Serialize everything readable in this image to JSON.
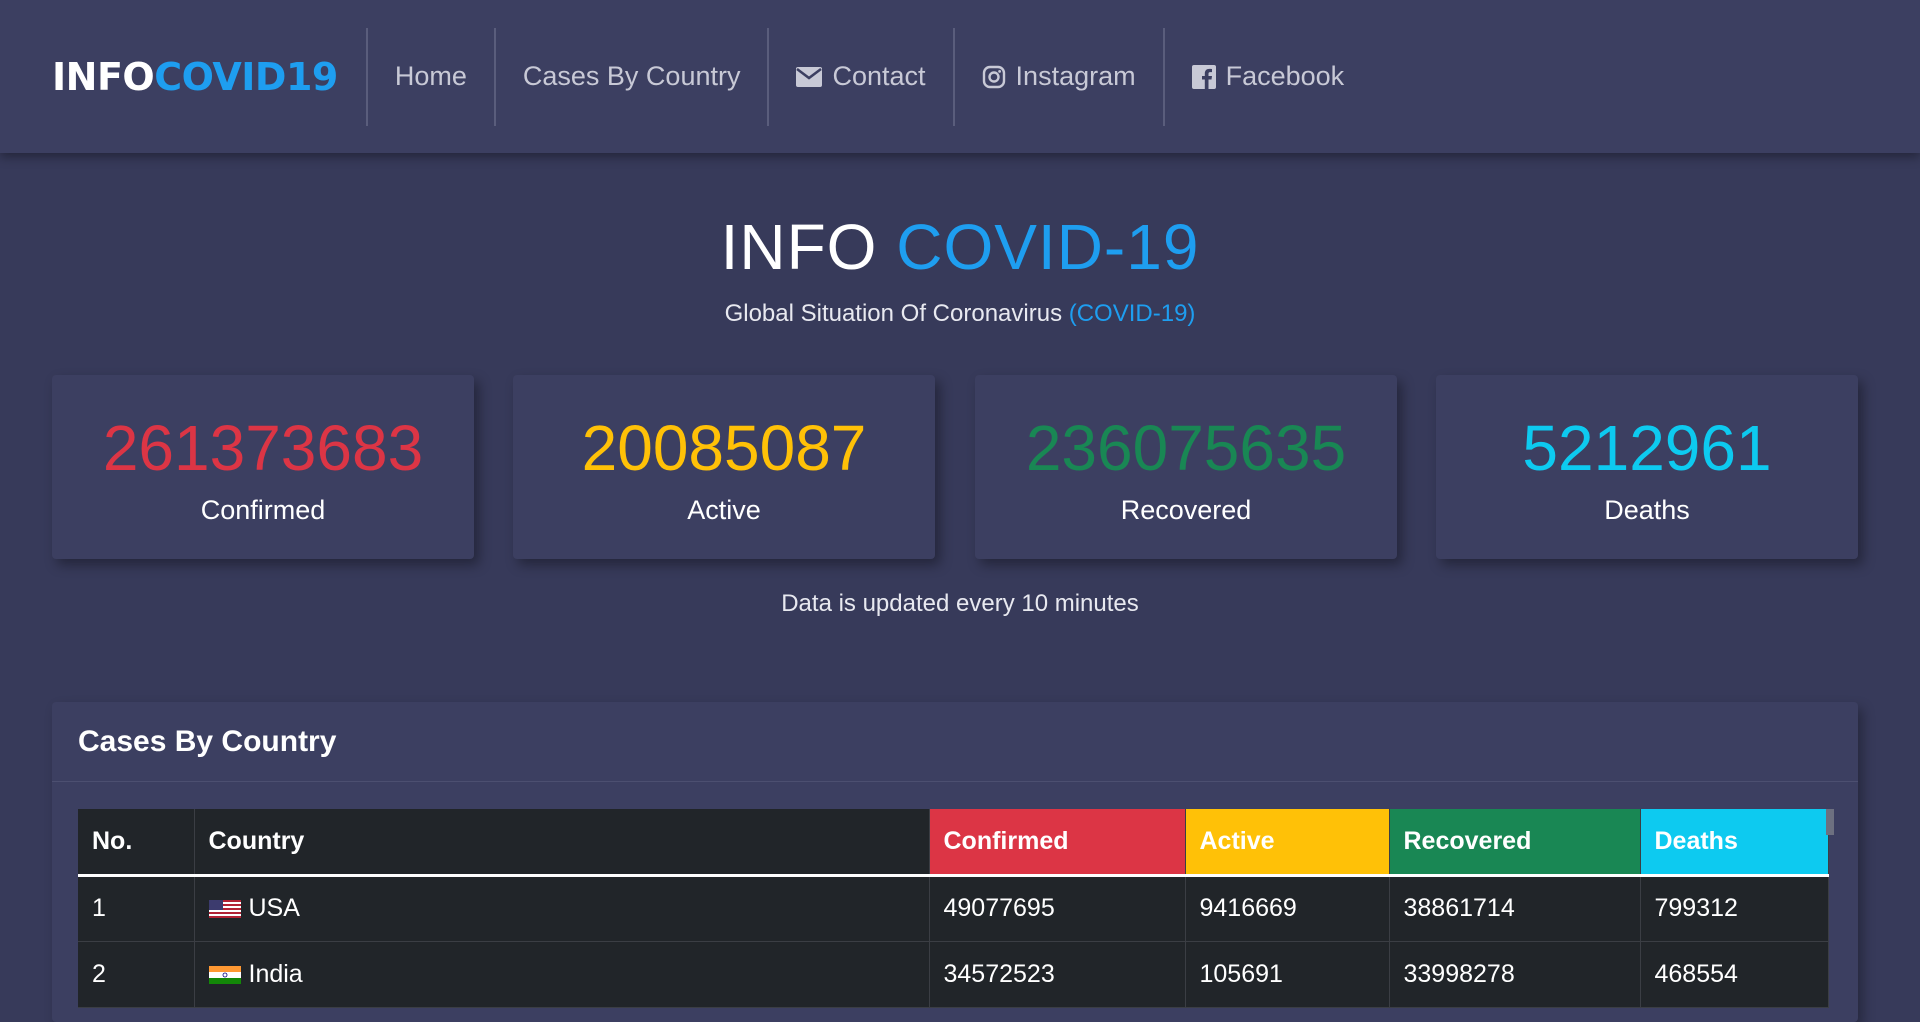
{
  "brand": {
    "part1": "INFO",
    "part2": "COVID19"
  },
  "nav": {
    "home": "Home",
    "cases": "Cases By Country",
    "contact": "Contact",
    "instagram": "Instagram",
    "facebook": "Facebook"
  },
  "hero": {
    "title_part1": "INFO",
    "title_part2": "COVID-19",
    "subtitle_part1": "Global Situation Of Coronavirus",
    "subtitle_part2": "(COVID-19)"
  },
  "stats": {
    "confirmed": {
      "value": "261373683",
      "label": "Confirmed",
      "color": "#dc3545"
    },
    "active": {
      "value": "20085087",
      "label": "Active",
      "color": "#ffc107"
    },
    "recovered": {
      "value": "236075635",
      "label": "Recovered",
      "color": "#198754"
    },
    "deaths": {
      "value": "5212961",
      "label": "Deaths",
      "color": "#0dcaf0"
    }
  },
  "update_note": "Data is updated every 10 minutes",
  "country_table": {
    "heading": "Cases By Country",
    "columns": {
      "no": "No.",
      "country": "Country",
      "confirmed": "Confirmed",
      "active": "Active",
      "recovered": "Recovered",
      "deaths": "Deaths"
    },
    "rows": [
      {
        "no": "1",
        "country": "USA",
        "flag": "us-flag-icon",
        "confirmed": "49077695",
        "active": "9416669",
        "recovered": "38861714",
        "deaths": "799312"
      },
      {
        "no": "2",
        "country": "India",
        "flag": "india-flag-icon",
        "confirmed": "34572523",
        "active": "105691",
        "recovered": "33998278",
        "deaths": "468554"
      }
    ]
  },
  "colors": {
    "background": "#373a5a",
    "panel": "#3c3f61",
    "accent_blue": "#1e9ef0",
    "table_dark": "#212529"
  }
}
